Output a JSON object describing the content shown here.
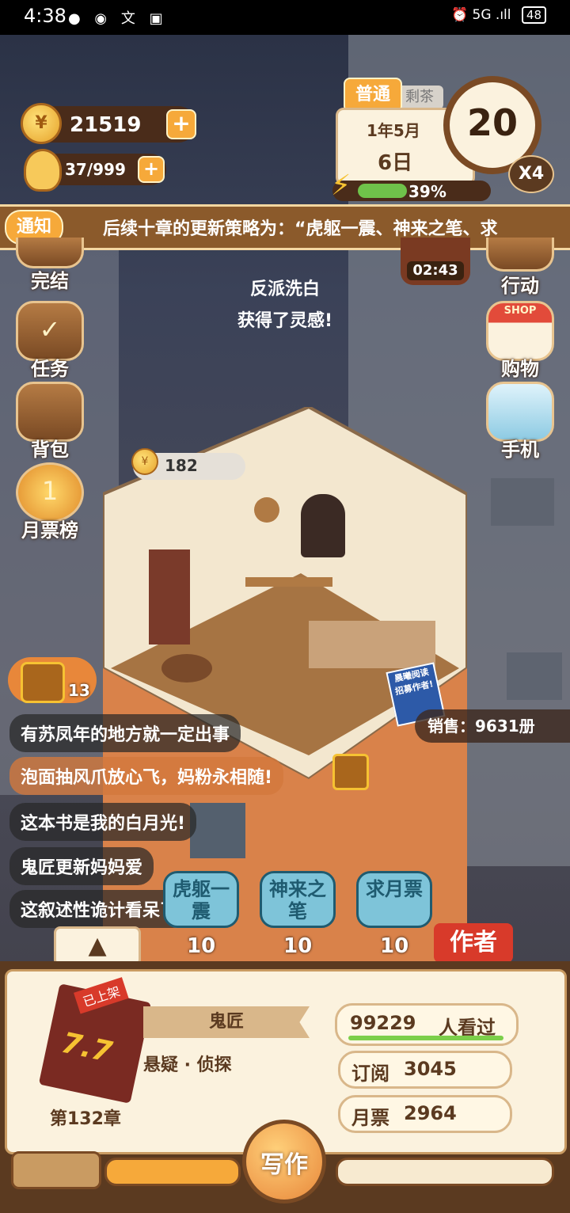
{
  "status_bar": {
    "time": "4:38",
    "right_text": "5G",
    "battery": "48"
  },
  "currency": {
    "coins": "21519",
    "inspiration": "37/999"
  },
  "date_panel": {
    "mode": "普通",
    "back_tab": "剩茶",
    "month_label": "1年5月",
    "day_label": "6日",
    "energy_percent": "39%",
    "energy_level": 0.39,
    "level": "20",
    "speed": "X4"
  },
  "notice": {
    "tag": "通知",
    "text": "后续十章的更新策略为：“虎躯一震、神来之笔、求"
  },
  "left_menu": {
    "complete": "完结",
    "tasks": "任务",
    "bag": "背包",
    "monthly_rank": "月票榜",
    "rank_badge": "1"
  },
  "right_menu": {
    "timer": "02:43",
    "action": "行动",
    "shop": "购物",
    "shop_sign": "SHOP",
    "phone": "手机"
  },
  "center_text": {
    "line1": "反派洗白",
    "line2": "获得了灵感!"
  },
  "room": {
    "bubble_value": "182",
    "poster": "晨曦阅读\n招募作者!"
  },
  "sales": "销售：9631册",
  "chest_count": "13",
  "comments": [
    "有苏凤年的地方就一定出事",
    "泡面抽风爪放心飞，妈粉永相随!",
    "这本书是我的白月光!",
    "鬼匠更新妈妈爱",
    "这叙述性诡计看呆了"
  ],
  "boosts": [
    {
      "label": "虎躯一震",
      "count": "10"
    },
    {
      "label": "神来之笔",
      "count": "10"
    },
    {
      "label": "求月票",
      "count": "10"
    }
  ],
  "author_button": "作者",
  "book": {
    "status": "已上架",
    "score": "7.7",
    "chapter": "第132章",
    "author": "鬼匠",
    "genre": "悬疑 · 侦探",
    "views": "99229",
    "views_label": "人看过",
    "subs_label": "订阅",
    "subs": "3045",
    "votes_label": "月票",
    "votes": "2964",
    "write_btn": "写作"
  }
}
